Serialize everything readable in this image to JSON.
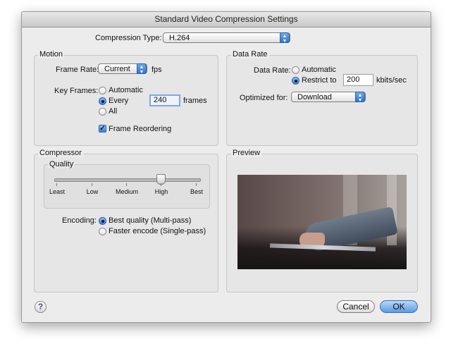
{
  "window": {
    "title": "Standard Video Compression Settings"
  },
  "compression": {
    "label": "Compression Type:",
    "value": "H.264"
  },
  "motion": {
    "group_title": "Motion",
    "frame_rate_label": "Frame Rate:",
    "frame_rate_value": "Current",
    "fps_label": "fps",
    "key_frames_label": "Key Frames:",
    "key_frame_options": [
      "Automatic",
      "Every",
      "All"
    ],
    "key_frame_selected": "Every",
    "key_frame_every_value": "240",
    "frames_label": "frames",
    "frame_reordering_label": "Frame Reordering",
    "frame_reordering_checked": true
  },
  "data_rate": {
    "group_title": "Data Rate",
    "label": "Data Rate:",
    "options": [
      "Automatic",
      "Restrict to"
    ],
    "selected": "Restrict to",
    "restrict_value": "200",
    "unit": "kbits/sec",
    "optimized_label": "Optimized for:",
    "optimized_value": "Download"
  },
  "compressor": {
    "group_title": "Compressor",
    "quality_title": "Quality",
    "quality_ticks": [
      "Least",
      "Low",
      "Medium",
      "High",
      "Best"
    ],
    "quality_value": "High",
    "encoding_label": "Encoding:",
    "encoding_options": [
      "Best quality (Multi-pass)",
      "Faster encode (Single-pass)"
    ],
    "encoding_selected": "Best quality (Multi-pass)"
  },
  "preview": {
    "group_title": "Preview"
  },
  "buttons": {
    "help": "?",
    "cancel": "Cancel",
    "ok": "OK"
  },
  "colors": {
    "accent": "#3a7fd8",
    "window_bg": "#ececec"
  }
}
